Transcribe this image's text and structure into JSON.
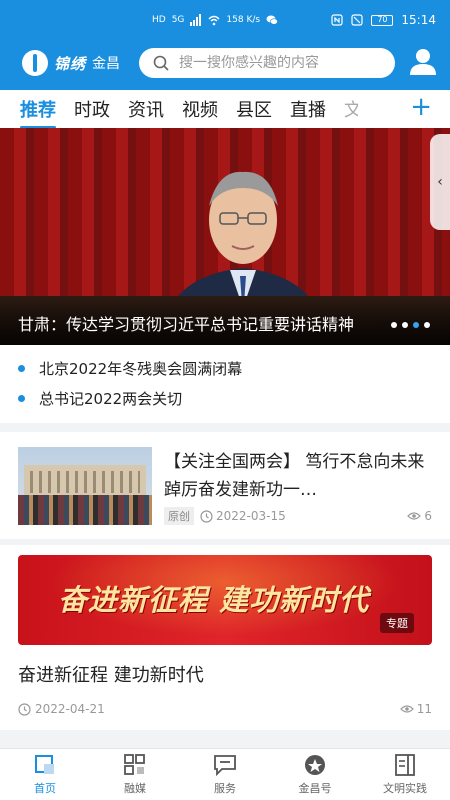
{
  "status_bar": {
    "network_labels": [
      "HD",
      "5G"
    ],
    "speed": "158 K/s",
    "time": "15:14",
    "battery": "70"
  },
  "header": {
    "logo_main": "锦绣",
    "logo_sub": "金昌",
    "search_placeholder": "搜一搜你感兴趣的内容"
  },
  "tabs": [
    {
      "label": "推荐",
      "active": true
    },
    {
      "label": "时政"
    },
    {
      "label": "资讯"
    },
    {
      "label": "视频"
    },
    {
      "label": "县区"
    },
    {
      "label": "直播"
    },
    {
      "label": "文"
    }
  ],
  "banner": {
    "title": "甘肃：传达学习贯彻习近平总书记重要讲话精神",
    "slide_count": 4,
    "active_slide": 3
  },
  "headlines": [
    "北京2022年冬残奥会圆满闭幕",
    "总书记2022两会关切"
  ],
  "article1": {
    "title": "【关注全国两会】 笃行不怠向未来 踔厉奋发建新功一…",
    "badge": "原创",
    "date": "2022-03-15",
    "views": "6"
  },
  "article2": {
    "promo_text": "奋进新征程 建功新时代",
    "tag": "专题",
    "title": "奋进新征程 建功新时代",
    "date": "2022-04-21",
    "views": "11"
  },
  "tabbar": [
    {
      "label": "首页",
      "icon": "home-icon",
      "active": true
    },
    {
      "label": "融媒",
      "icon": "media-icon"
    },
    {
      "label": "服务",
      "icon": "service-icon"
    },
    {
      "label": "金昌号",
      "icon": "jinchang-icon"
    },
    {
      "label": "文明实践",
      "icon": "civilization-icon"
    }
  ],
  "colors": {
    "brand": "#1a8fe0",
    "banner_bg": "#8a1010",
    "promo_red": "#d0151d"
  }
}
